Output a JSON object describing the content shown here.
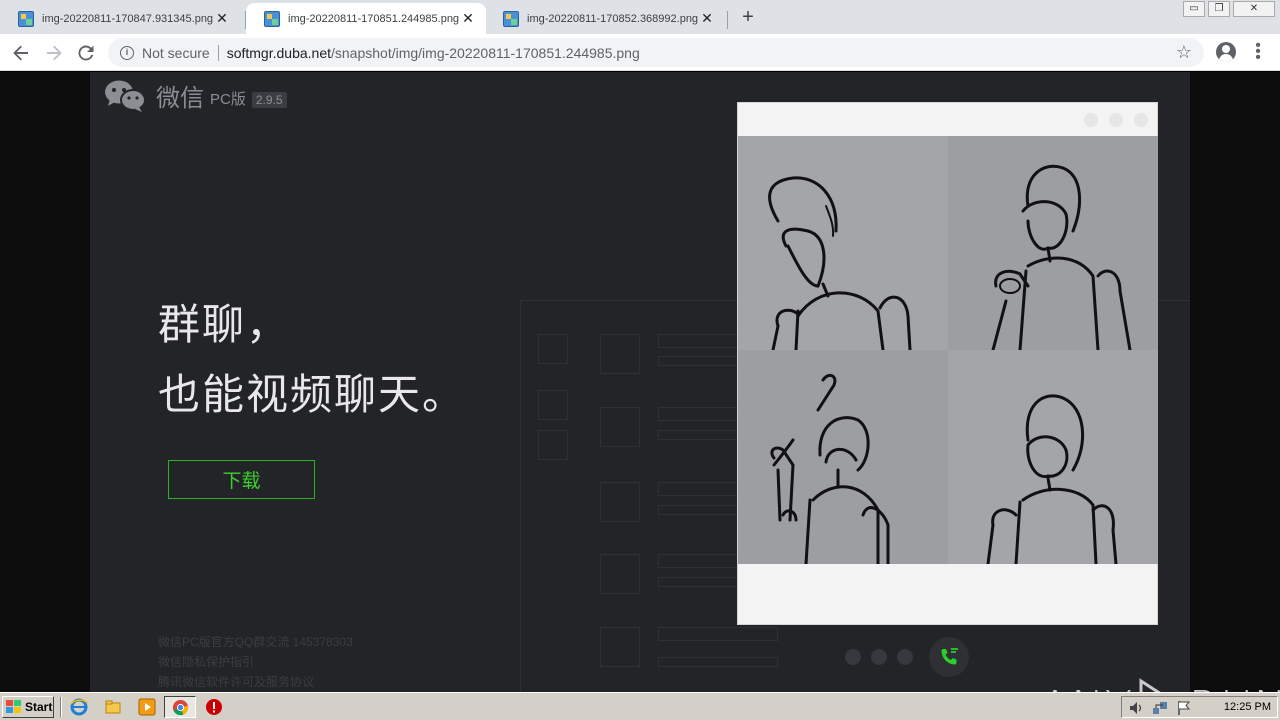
{
  "browser": {
    "tabs": [
      {
        "title": "img-20220811-170847.931345.png (",
        "close": "✕"
      },
      {
        "title": "img-20220811-170851.244985.png (",
        "close": "✕"
      },
      {
        "title": "img-20220811-170852.368992.png (",
        "close": "✕"
      }
    ],
    "new_tab": "+",
    "window_controls": {
      "minimize": "▭",
      "restore": "❐",
      "close": "✕"
    },
    "omnibox": {
      "security": "Not secure",
      "host": "softmgr.duba.net",
      "path": "/snapshot/img/img-20220811-170851.244985.png"
    }
  },
  "page": {
    "logo": {
      "brand": "微信",
      "pc": "PC版",
      "version": "2.9.5"
    },
    "headline": {
      "line1": "群聊，",
      "line2": "也能视频聊天。"
    },
    "download_label": "下载",
    "footer": [
      "微信PC版官方QQ群交流 145378303",
      "微信隐私保护指引",
      "腾讯微信软件许可及服务协议"
    ],
    "accent_color": "#29b023"
  },
  "watermark": {
    "left": "ANY",
    "right": "RUN"
  },
  "taskbar": {
    "start_label": "Start",
    "clock": "12:25 PM"
  }
}
